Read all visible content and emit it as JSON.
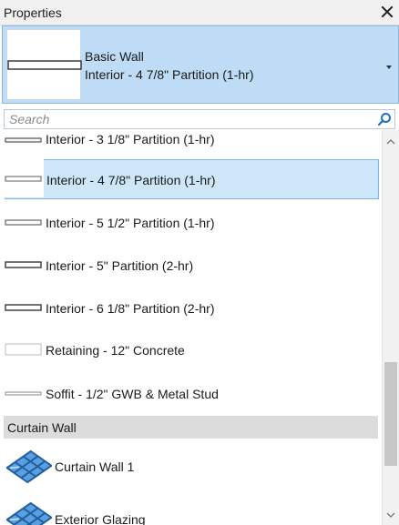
{
  "panel": {
    "title": "Properties"
  },
  "type_selector": {
    "family": "Basic Wall",
    "type_name": "Interior - 4 7/8\" Partition (1-hr)"
  },
  "search": {
    "placeholder": "Search",
    "value": ""
  },
  "type_list": {
    "items": [
      {
        "label": "Interior - 3 1/8\" Partition (1-hr)",
        "icon": "wall-type-thumbnail",
        "selected": false
      },
      {
        "label": "Interior - 4 7/8\" Partition (1-hr)",
        "icon": "wall-type-thumbnail",
        "selected": true
      },
      {
        "label": "Interior - 5 1/2\" Partition (1-hr)",
        "icon": "wall-type-thumbnail",
        "selected": false
      },
      {
        "label": "Interior - 5\" Partition (2-hr)",
        "icon": "wall-type-thumbnail",
        "selected": false
      },
      {
        "label": "Interior - 6 1/8\" Partition (2-hr)",
        "icon": "wall-type-thumbnail",
        "selected": false
      },
      {
        "label": "Retaining - 12\" Concrete",
        "icon": "wall-type-thumbnail",
        "selected": false
      },
      {
        "label": "Soffit - 1/2\" GWB & Metal Stud",
        "icon": "wall-type-thumbnail",
        "selected": false
      }
    ],
    "group_header": "Curtain Wall",
    "curtain_items": [
      {
        "label": "Curtain Wall 1",
        "icon": "curtain-wall-icon"
      },
      {
        "label": "Exterior Glazing",
        "icon": "curtain-wall-icon"
      }
    ]
  },
  "colors": {
    "selector_bg": "#bfdcf6",
    "selected_row_bg": "#cde7f9",
    "selected_row_border": "#7eb4ea",
    "group_header_bg": "#dcdcdc",
    "search_icon": "#1e6fc4"
  }
}
